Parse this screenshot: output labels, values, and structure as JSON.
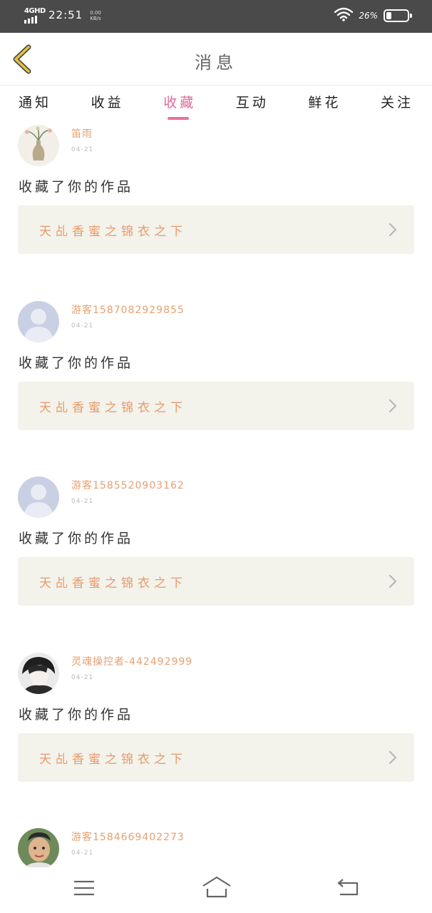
{
  "status_bar": {
    "network": "4GHD",
    "time": "22:51",
    "speed_value": "0.00",
    "speed_unit": "KB/s",
    "battery_percent": "26%",
    "battery_level": 0.26,
    "icons": [
      "signal-icon",
      "wifi-icon",
      "battery-icon"
    ]
  },
  "header": {
    "title": "消息",
    "back_icon": "chevron-left-icon",
    "accent_color": "#e8c23c"
  },
  "tabs": [
    {
      "label": "通知",
      "active": false
    },
    {
      "label": "收益",
      "active": false
    },
    {
      "label": "收藏",
      "active": true
    },
    {
      "label": "互动",
      "active": false
    },
    {
      "label": "鲜花",
      "active": false
    },
    {
      "label": "关注",
      "active": false
    }
  ],
  "active_tab_color": "#e8709e",
  "items": [
    {
      "username": "笛雨",
      "date": "04-21",
      "action": "收藏了你的作品",
      "work_title": "天乩香蜜之锦衣之下",
      "avatar": "vase-avatar"
    },
    {
      "username": "游客1587082929855",
      "date": "04-21",
      "action": "收藏了你的作品",
      "work_title": "天乩香蜜之锦衣之下",
      "avatar": "default-avatar"
    },
    {
      "username": "游客1585520903162",
      "date": "04-21",
      "action": "收藏了你的作品",
      "work_title": "天乩香蜜之锦衣之下",
      "avatar": "default-avatar"
    },
    {
      "username": "灵魂操控者-442492999",
      "date": "04-21",
      "action": "收藏了你的作品",
      "work_title": "天乩香蜜之锦衣之下",
      "avatar": "anime-avatar"
    },
    {
      "username": "游客1584669402273",
      "date": "04-21",
      "action": "",
      "work_title": "",
      "avatar": "child-photo-avatar"
    }
  ],
  "navbar": {
    "icons": [
      "menu-icon",
      "home-icon",
      "back-icon"
    ]
  }
}
